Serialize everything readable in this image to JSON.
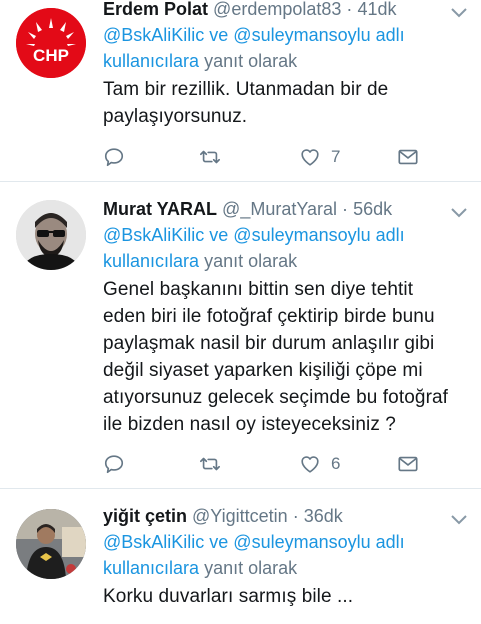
{
  "colors": {
    "link": "#1b95e0",
    "muted": "#657786",
    "text": "#14171a",
    "chp_red": "#e30a17",
    "divider": "#e1e8ed"
  },
  "reply_suffix": "yanıt olarak",
  "tweets": [
    {
      "name": "Erdem Polat",
      "handle": "@erdempolat83",
      "dot": "·",
      "time": "41dk",
      "avatar_icon": "chp-logo",
      "avatar_logo_text": "CHP",
      "reply_line1": "@BskAliKilic ve @suleymansoylu adlı",
      "reply_line2_link": "kullanıcılara",
      "text_lines": [
        "Tam bir rezillik. Utanmadan bir de",
        "paylaşıyorsunuz."
      ],
      "reply_count": "",
      "retweet_count": "",
      "like_count": "7"
    },
    {
      "name": "Murat YARAL",
      "handle": "@_MuratYaral",
      "dot": "·",
      "time": "56dk",
      "avatar_icon": "person-photo",
      "reply_line1": "@BskAliKilic ve @suleymansoylu adlı",
      "reply_line2_link": "kullanıcılara",
      "text_lines": [
        "Genel başkanını bittin sen diye tehtit",
        "eden biri ile fotoğraf çektirip birde bunu",
        "paylaşmak nasil bir durum anlaşılır gibi",
        "değil siyaset yaparken kişiliği çöpe mi",
        "atıyorsunuz gelecek seçimde bu fotoğraf",
        "ile bizden nasıl oy isteyeceksiniz ?"
      ],
      "reply_count": "",
      "retweet_count": "",
      "like_count": "6"
    },
    {
      "name": "yiğit çetin",
      "handle": "@Yigittcetin",
      "dot": "·",
      "time": "36dk",
      "avatar_icon": "person-photo",
      "reply_line1": "@BskAliKilic ve @suleymansoylu adlı",
      "reply_line2_link": "kullanıcılara",
      "text_lines": [
        "Korku duvarları sarmış bile ..."
      ]
    }
  ]
}
